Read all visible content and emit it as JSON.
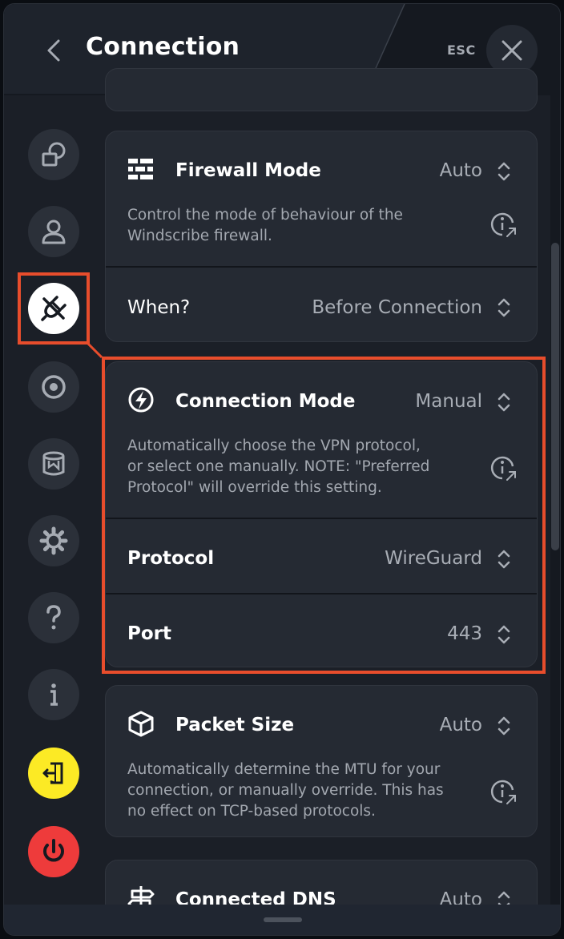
{
  "header": {
    "title": "Connection",
    "esc_label": "ESC"
  },
  "sidebar": {
    "items": [
      {
        "name": "general",
        "icon": "general-settings-icon"
      },
      {
        "name": "account",
        "icon": "user-icon"
      },
      {
        "name": "connection",
        "icon": "plug-icon",
        "active": true
      },
      {
        "name": "robert",
        "icon": "robert-icon"
      },
      {
        "name": "advanced",
        "icon": "database-icon"
      },
      {
        "name": "settings",
        "icon": "gear-icon"
      },
      {
        "name": "help",
        "icon": "question-icon"
      },
      {
        "name": "about",
        "icon": "info-icon"
      },
      {
        "name": "logout",
        "icon": "logout-icon",
        "color": "#fcea25"
      },
      {
        "name": "quit",
        "icon": "power-icon",
        "color": "#ee3b3b"
      }
    ]
  },
  "firewall": {
    "title": "Firewall Mode",
    "value": "Auto",
    "description": "Control the mode of behaviour of the Windscribe firewall.",
    "when_label": "When?",
    "when_value": "Before Connection"
  },
  "connection_mode": {
    "title": "Connection Mode",
    "value": "Manual",
    "description": "Automatically choose the VPN protocol, or select one manually. NOTE: \"Preferred Protocol\" will override this setting.",
    "protocol_label": "Protocol",
    "protocol_value": "WireGuard",
    "port_label": "Port",
    "port_value": "443"
  },
  "packet_size": {
    "title": "Packet Size",
    "value": "Auto",
    "description": "Automatically determine the MTU for your connection, or manually override.  This has no effect on TCP-based protocols."
  },
  "connected_dns": {
    "title": "Connected DNS",
    "value": "Auto"
  },
  "colors": {
    "highlight": "#e84d2c",
    "background": "#1b1f27",
    "card": "#252a33",
    "yellow_button": "#fcea25",
    "red_button": "#ee3b3b"
  }
}
